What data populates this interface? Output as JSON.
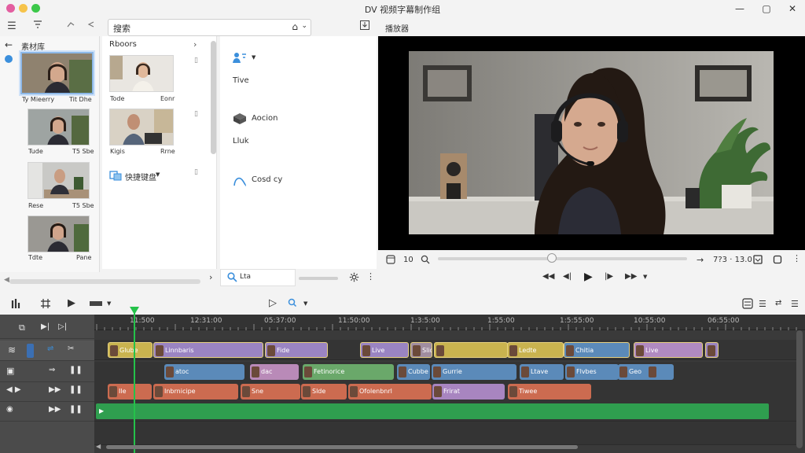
{
  "window": {
    "title": "DV 视频字幕制作组",
    "controls": {
      "minimize": "—",
      "maximize": "▢",
      "close": "✕"
    }
  },
  "top_toolbar": {
    "search_text": "搜索",
    "home_icon": "⌂",
    "dropdown": "⌄"
  },
  "library": {
    "title": "素材库",
    "items": [
      {
        "left": "Ty Mieerry",
        "right": "Tit Dhe"
      },
      {
        "left": "Tude",
        "right": "T5 Sbe"
      },
      {
        "left": "Rese",
        "right": "T5 Sbe"
      },
      {
        "left": "Tdte",
        "right": "Pane"
      }
    ]
  },
  "browser": {
    "title": "Rboors",
    "items": [
      {
        "left": "Tode",
        "right": "Eonr"
      },
      {
        "left": "Kigis",
        "right": "Rrne"
      }
    ],
    "folder_label": "快捷键盘"
  },
  "properties": {
    "items": [
      {
        "label": "Tive",
        "icon": "people-icon"
      },
      {
        "label": "Aocion",
        "icon": "cube-icon"
      },
      {
        "label": "Lluk",
        "icon": ""
      },
      {
        "label": "Cosd cy",
        "icon": "curve-icon"
      }
    ]
  },
  "footer": {
    "search_value": "Lta"
  },
  "preview": {
    "title": "播放器",
    "frame_counter": "10",
    "timecode": "7?3 · 13.0"
  },
  "timeline": {
    "ruler_labels": [
      "11:500",
      "12:31:00",
      "05:37:00",
      "11:50:00",
      "1:3:5:00",
      "1:55:00",
      "1:5:55:00",
      "10:55:00",
      "06:55:00"
    ],
    "tracks": [
      {
        "clips": [
          {
            "label": "Glube",
            "color": "#c9b34f"
          },
          {
            "label": "Linnbaris",
            "color": "#9a84c2"
          },
          {
            "label": "Fide",
            "color": "#9a84c2"
          },
          {
            "label": "Live",
            "color": "#9a84c2"
          },
          {
            "label": "Slide",
            "color": "#a08da0"
          },
          {
            "label": "",
            "color": "#c9b34f"
          },
          {
            "label": "Ledte",
            "color": "#c9b34f"
          },
          {
            "label": "Chitia",
            "color": "#5b8ab9"
          },
          {
            "label": "Live",
            "color": "#b08ac0"
          },
          {
            "label": "",
            "color": "#9a84c2"
          }
        ]
      },
      {
        "clips": [
          {
            "label": "atoc",
            "color": "#5b8ab9"
          },
          {
            "label": "dac",
            "color": "#b98ab8"
          },
          {
            "label": "Fetinorice",
            "color": "#6aa86a"
          },
          {
            "label": "Cubbe",
            "color": "#5b8ab9"
          },
          {
            "label": "Gurrie",
            "color": "#5b8ab9"
          },
          {
            "label": "Ltave",
            "color": "#5b8ab9"
          },
          {
            "label": "Flvbes",
            "color": "#5b8ab9"
          },
          {
            "label": "Geo",
            "color": "#5b8ab9"
          },
          {
            "label": "",
            "color": "#5b8ab9"
          }
        ]
      },
      {
        "clips": [
          {
            "label": "Ile",
            "color": "#cc6b50"
          },
          {
            "label": "Inbrnicipe",
            "color": "#cc6b50"
          },
          {
            "label": "Sne",
            "color": "#cc6b50"
          },
          {
            "label": "Slde",
            "color": "#cc6b50"
          },
          {
            "label": "Ofolenbnrl",
            "color": "#cc6b50"
          },
          {
            "label": "Frirat",
            "color": "#a885c0"
          },
          {
            "label": "Tiwee",
            "color": "#cc6b50"
          }
        ]
      },
      {
        "clips": [
          {
            "label": "",
            "color": "#2f9e4f"
          }
        ]
      }
    ]
  }
}
